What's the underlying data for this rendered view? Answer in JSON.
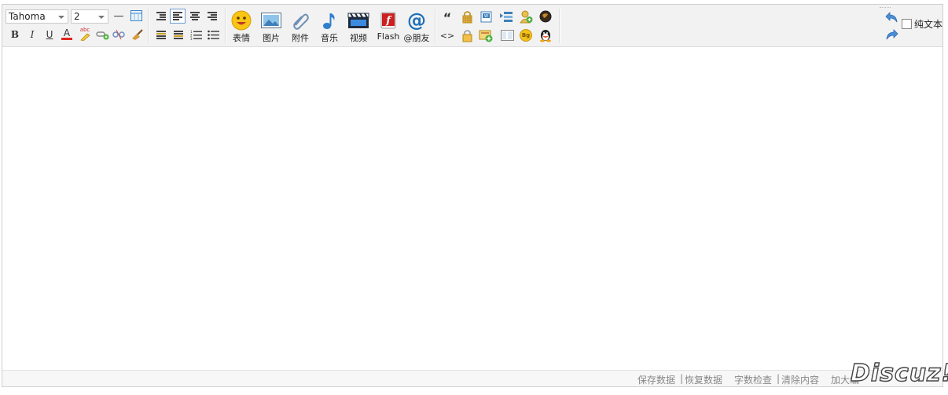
{
  "toolbar": {
    "font_family": "Tahoma",
    "font_size": "2",
    "row1_small": [
      {
        "name": "horizontal-rule-icon",
        "glyph": "—"
      },
      {
        "name": "table-icon",
        "glyph": ""
      }
    ],
    "format": {
      "bold": "B",
      "italic": "I",
      "underline": "U",
      "font_color": "A",
      "highlight": "abc"
    },
    "big_buttons": [
      {
        "name": "emoticon",
        "label": "表情"
      },
      {
        "name": "image",
        "label": "图片"
      },
      {
        "name": "attachment",
        "label": "附件"
      },
      {
        "name": "music",
        "label": "音乐"
      },
      {
        "name": "video",
        "label": "视频"
      },
      {
        "name": "flash",
        "label": "Flash"
      },
      {
        "name": "mention",
        "label": "@朋友"
      }
    ],
    "quote_glyph": "“",
    "code_glyph": "<>",
    "bg_label": "Bg",
    "plain_text_label": "纯文本"
  },
  "status": {
    "save_data": "保存数据",
    "divider1": "|",
    "restore_data": "恢复数据",
    "word_check": "字数检查",
    "divider2": "|",
    "clear_content": "清除内容",
    "enlarge": "加大编",
    "logo": "Discuz!"
  }
}
